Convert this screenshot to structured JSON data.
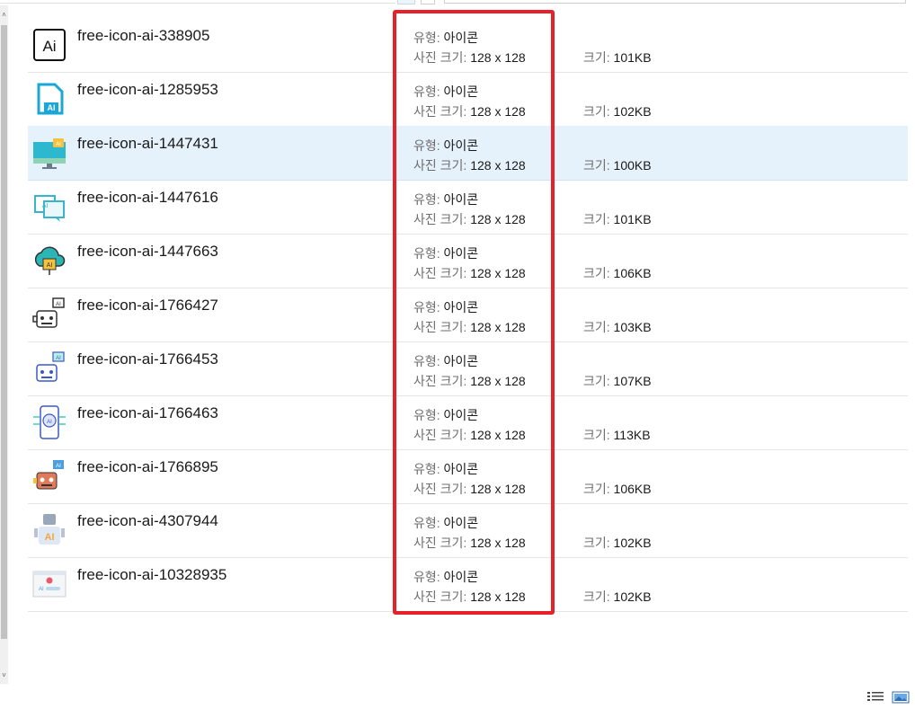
{
  "files": [
    {
      "name": "free-icon-ai-338905",
      "type": "아이콘",
      "dimensions": "128 x 128",
      "size": "101KB",
      "icon": "ai-square-icon",
      "selected": false
    },
    {
      "name": "free-icon-ai-1285953",
      "type": "아이콘",
      "dimensions": "128 x 128",
      "size": "102KB",
      "icon": "ai-outline-badge-icon",
      "selected": false
    },
    {
      "name": "free-icon-ai-1447431",
      "type": "아이콘",
      "dimensions": "128 x 128",
      "size": "100KB",
      "icon": "ai-monitor-icon",
      "selected": true
    },
    {
      "name": "free-icon-ai-1447616",
      "type": "아이콘",
      "dimensions": "128 x 128",
      "size": "101KB",
      "icon": "ai-chat-bubbles-icon",
      "selected": false
    },
    {
      "name": "free-icon-ai-1447663",
      "type": "아이콘",
      "dimensions": "128 x 128",
      "size": "106KB",
      "icon": "ai-cloud-icon",
      "selected": false
    },
    {
      "name": "free-icon-ai-1766427",
      "type": "아이콘",
      "dimensions": "128 x 128",
      "size": "103KB",
      "icon": "ai-robot-outline-icon",
      "selected": false
    },
    {
      "name": "free-icon-ai-1766453",
      "type": "아이콘",
      "dimensions": "128 x 128",
      "size": "107KB",
      "icon": "ai-robot-blue-icon",
      "selected": false
    },
    {
      "name": "free-icon-ai-1766463",
      "type": "아이콘",
      "dimensions": "128 x 128",
      "size": "113KB",
      "icon": "ai-phone-icon",
      "selected": false
    },
    {
      "name": "free-icon-ai-1766895",
      "type": "아이콘",
      "dimensions": "128 x 128",
      "size": "106KB",
      "icon": "ai-robot-color-icon",
      "selected": false
    },
    {
      "name": "free-icon-ai-4307944",
      "type": "아이콘",
      "dimensions": "128 x 128",
      "size": "102KB",
      "icon": "ai-robot-figure-icon",
      "selected": false
    },
    {
      "name": "free-icon-ai-10328935",
      "type": "아이콘",
      "dimensions": "128 x 128",
      "size": "102KB",
      "icon": "ai-browser-window-icon",
      "selected": false
    }
  ],
  "labels": {
    "type": "유형:",
    "dimensions": "사진 크기:",
    "size": "크기:"
  },
  "colors": {
    "highlight": "#e8202a",
    "selected_row": "#e5f1fb"
  },
  "view_buttons": [
    "details-view-icon",
    "preview-view-icon"
  ]
}
